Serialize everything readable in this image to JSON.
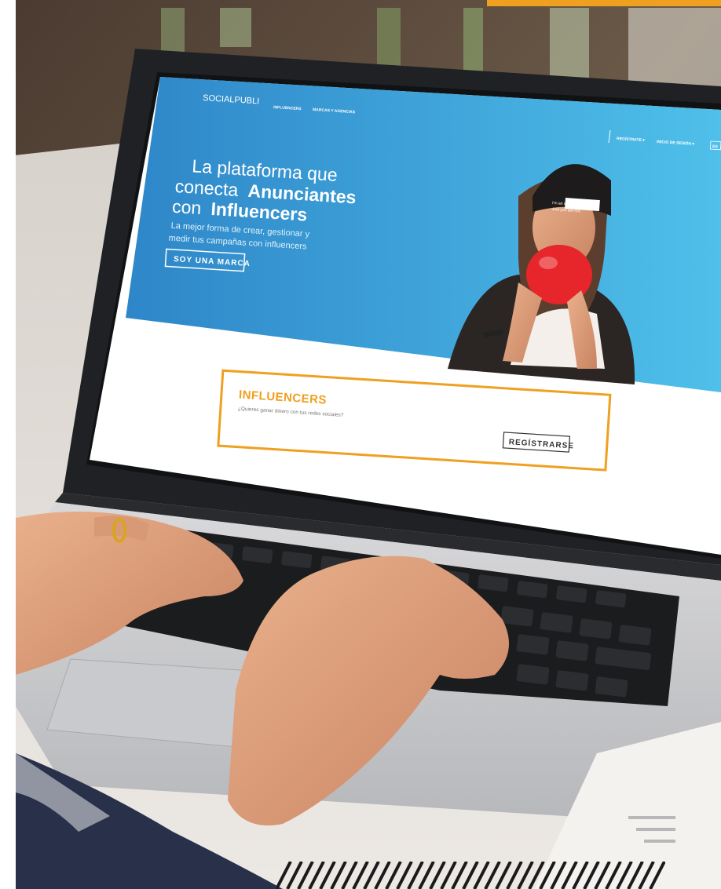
{
  "site": {
    "logo": "SOCIALPUBLI",
    "nav": [
      "INFLUENCERS",
      "MARCAS Y AGENCIAS"
    ],
    "nav_right": [
      "REGÍSTRATE ▾",
      "INICIO DE SESIÓN ▾",
      "ES"
    ]
  },
  "hero": {
    "line1": "La plataforma que",
    "line2_light": "conecta",
    "line2_bold": "Anunciantes",
    "line3_light": "con",
    "line3_bold": "Influencers",
    "sub1": "La mejor forma de crear, gestionar y",
    "sub2": "medir tus campañas con influencers",
    "cta": "SOY UNA MARCA",
    "beanie_text1": "I'm an influencer.",
    "beanie_text2": "And you are not."
  },
  "card": {
    "title": "INFLUENCERS",
    "subtitle": "¿Quieres ganar dinero con tus redes sociales?",
    "button": "REGÍSTRARSE"
  },
  "colors": {
    "accent": "#f0a020",
    "hero_blue_light": "#5ac8ee",
    "hero_blue_dark": "#2a7fc4",
    "text_dark": "#333333"
  }
}
